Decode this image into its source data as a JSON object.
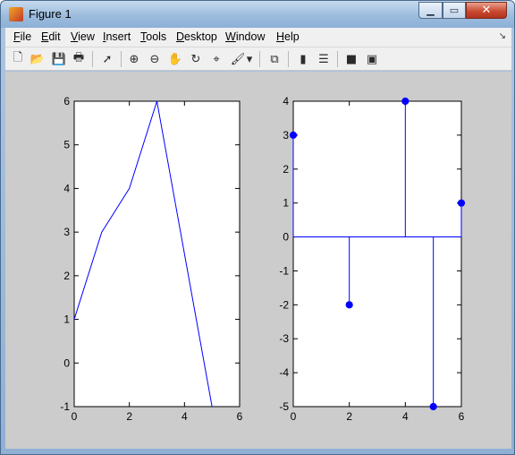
{
  "window": {
    "title": "Figure 1",
    "minimize_glyph": "▁",
    "maximize_glyph": "▭",
    "close_glyph": "✕"
  },
  "menubar": {
    "items": [
      "File",
      "Edit",
      "View",
      "Insert",
      "Tools",
      "Desktop",
      "Window",
      "Help"
    ],
    "overflow_glyph": "↘"
  },
  "toolbar": {
    "icons": [
      {
        "name": "new-figure-icon",
        "glyph": "🗋"
      },
      {
        "name": "open-file-icon",
        "glyph": "📂"
      },
      {
        "name": "save-icon",
        "glyph": "💾"
      },
      {
        "name": "print-icon",
        "glyph": "🖶"
      },
      {
        "name": "select-arrow-icon",
        "glyph": "➚"
      },
      {
        "name": "zoom-in-icon",
        "glyph": "⊕"
      },
      {
        "name": "zoom-out-icon",
        "glyph": "⊖"
      },
      {
        "name": "pan-hand-icon",
        "glyph": "✋"
      },
      {
        "name": "rotate-3d-icon",
        "glyph": "↻"
      },
      {
        "name": "data-cursor-icon",
        "glyph": "⌖"
      },
      {
        "name": "brush-icon",
        "glyph": "🖌"
      },
      {
        "name": "brush-dropdown-icon",
        "glyph": "▾"
      },
      {
        "name": "link-plot-icon",
        "glyph": "⧉"
      },
      {
        "name": "colorbar-icon",
        "glyph": "▮"
      },
      {
        "name": "legend-icon",
        "glyph": "☰"
      },
      {
        "name": "hide-plot-tools-icon",
        "glyph": "■"
      },
      {
        "name": "show-plot-tools-icon",
        "glyph": "▣"
      }
    ]
  },
  "colors": {
    "figure_bg": "#cccccc",
    "axes_bg": "#ffffff",
    "line": "#0000ff"
  },
  "chart_data": [
    {
      "type": "line",
      "x": [
        0,
        1,
        2,
        3,
        4,
        5
      ],
      "y": [
        1,
        3,
        4,
        6,
        2.5,
        -1
      ],
      "xlim": [
        0,
        6
      ],
      "ylim": [
        -1,
        6
      ],
      "xticks": [
        "0",
        "2",
        "4",
        "6"
      ],
      "yticks": [
        "-1",
        "0",
        "1",
        "2",
        "3",
        "4",
        "5",
        "6"
      ],
      "grid": false
    },
    {
      "type": "stem",
      "x": [
        0,
        2,
        4,
        5,
        6
      ],
      "y": [
        3,
        -2,
        4,
        -5,
        1
      ],
      "baseline": 0,
      "xlim": [
        0,
        6
      ],
      "ylim": [
        -5,
        4
      ],
      "xticks": [
        "0",
        "2",
        "4",
        "6"
      ],
      "yticks": [
        "-5",
        "-4",
        "-3",
        "-2",
        "-1",
        "0",
        "1",
        "2",
        "3",
        "4"
      ],
      "grid": false
    }
  ]
}
